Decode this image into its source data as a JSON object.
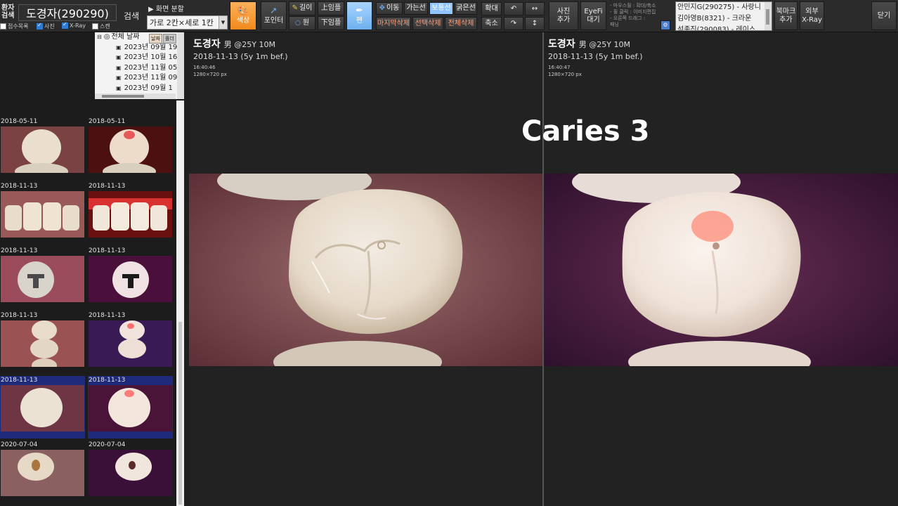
{
  "toolbar": {
    "patient_search_label": "환자\n검색",
    "patient_name": "도경자(290290)",
    "search_button": "검색",
    "checkbox_reception": "접수목록",
    "checkbox_photo": "사진",
    "checkbox_xray": "X-Ray",
    "checkbox_scan": "스캔",
    "split_label": "▶ 화면 분할",
    "split_value": "가로 2칸×세로 1칸",
    "color_button": "색상",
    "pointer_button": "포인터",
    "length_button": "길이",
    "circle_button": "원",
    "upper_button": "上임플",
    "lower_button": "下임플",
    "pen_button": "펜",
    "move_button": "이동",
    "thin_line_button": "가는선",
    "normal_line_button": "보통선",
    "thick_line_button": "굵은선",
    "delete_last_button": "마지막삭제",
    "delete_selected_button": "선택삭제",
    "delete_all_button": "전체삭제",
    "zoom_in_button": "확대",
    "zoom_out_button": "축소",
    "add_photo_button": "사진\n추가",
    "eyefi_button": "EyeFi\n대기",
    "hint_lines": [
      "- 마우스휠 : 확대/축소",
      "- 휠 클릭 : 이미지편집",
      "- 오른쪽 드래그 :",
      "  패닝"
    ],
    "bookmark_button": "북마크\n추가",
    "external_xray_button": "외부\nX-Ray",
    "close_button": "닫기",
    "patient_list": [
      "안민지G(290275) - 사랑니",
      "김아영B(8321) - 크라운",
      "석종진(290083) - 레이스"
    ]
  },
  "tree": {
    "root_label": "전체 날짜",
    "tab_date": "날짜",
    "tab_folder": "폴더",
    "items": [
      "2023년 09월 19",
      "2023년 10월 16",
      "2023년 11월 05",
      "2023년 11월 09",
      "2023년 09월 1"
    ]
  },
  "thumbnails": {
    "dates": [
      "2018-05-11",
      "2018-05-11",
      "2018-11-13",
      "2018-11-13",
      "2018-11-13",
      "2018-11-13",
      "2018-11-13",
      "2018-11-13",
      "2018-11-13",
      "2018-11-13",
      "2020-07-04",
      "2020-07-04"
    ]
  },
  "viewer": {
    "left": {
      "name": "도경자",
      "sex_age": "男 @25Y 10M",
      "date": "2018-11-13 (5y 1m bef.)",
      "time": "16:40:46",
      "size": "1280×720 px"
    },
    "right": {
      "name": "도경자",
      "sex_age": "男 @25Y 10M",
      "date": "2018-11-13 (5y 1m bef.)",
      "time": "16:40:47",
      "size": "1280×720 px"
    },
    "caption": "Caries 3"
  }
}
